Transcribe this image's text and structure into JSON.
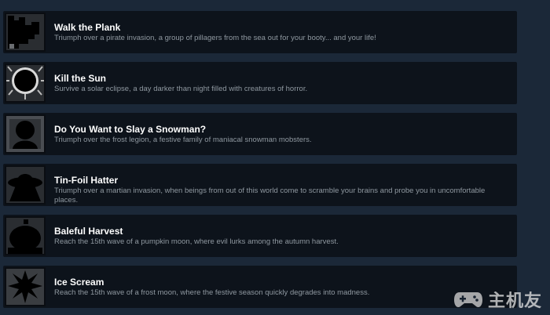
{
  "achievements": [
    {
      "title": "Walk the Plank",
      "description": "Triumph over a pirate invasion, a group of pillagers from the sea out for your booty... and your life!",
      "icon": "pirate-ship-icon"
    },
    {
      "title": "Kill the Sun",
      "description": "Survive a solar eclipse, a day darker than night filled with creatures of horror.",
      "icon": "eclipse-icon"
    },
    {
      "title": "Do You Want to Slay a Snowman?",
      "description": "Triumph over the frost legion, a festive family of maniacal snowman mobsters.",
      "icon": "snowman-icon"
    },
    {
      "title": "Tin-Foil Hatter",
      "description": "Triumph over a martian invasion, when beings from out of this world come to scramble your brains and probe you in uncomfortable places.",
      "icon": "ufo-icon"
    },
    {
      "title": "Baleful Harvest",
      "description": "Reach the 15th wave of a pumpkin moon, where evil lurks among the autumn harvest.",
      "icon": "pumpkin-icon"
    },
    {
      "title": "Ice Scream",
      "description": "Reach the 15th wave of a frost moon, where the festive season quickly degrades into madness.",
      "icon": "snowflake-icon"
    }
  ],
  "watermark": {
    "text": "主机友"
  }
}
